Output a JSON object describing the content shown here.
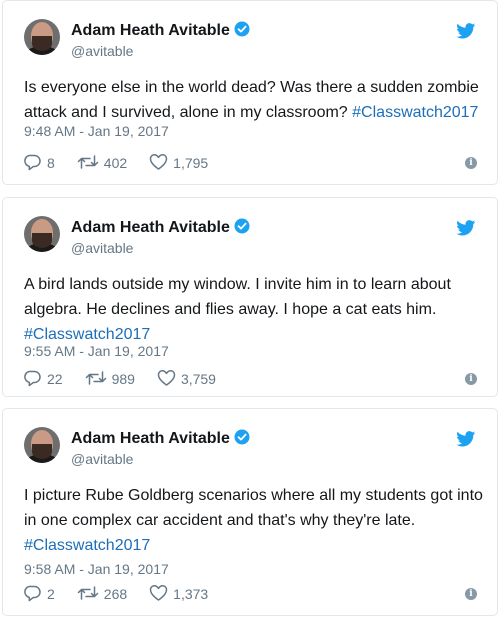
{
  "tweets": [
    {
      "author": "Adam Heath Avitable",
      "handle": "@avitable",
      "text": "Is everyone else in the world dead? Was there a sudden zombie attack and I survived, alone in my classroom? ",
      "hashtag": "#Classwatch2017",
      "date": "9:48 AM - Jan 19, 2017",
      "replies": "8",
      "retweets": "402",
      "likes": "1,795"
    },
    {
      "author": "Adam Heath Avitable",
      "handle": "@avitable",
      "text": "A bird lands outside my window. I invite him in to learn about algebra. He declines and flies away. I hope a cat eats him. ",
      "hashtag": "#Classwatch2017",
      "date": "9:55 AM - Jan 19, 2017",
      "replies": "22",
      "retweets": "989",
      "likes": "3,759"
    },
    {
      "author": "Adam Heath Avitable",
      "handle": "@avitable",
      "text": "I picture Rube Goldberg scenarios where all my students got into in one complex car accident and that's why they're late. ",
      "hashtag": "#Classwatch2017",
      "date": "9:58 AM - Jan 19, 2017",
      "replies": "2",
      "retweets": "268",
      "likes": "1,373"
    }
  ],
  "icons": {
    "verified": "verified-badge-icon",
    "brand": "twitter-bird-icon",
    "reply": "reply-icon",
    "retweet": "retweet-icon",
    "like": "heart-icon",
    "info": "info-icon"
  },
  "colors": {
    "brand": "#1da1f2",
    "hashtag": "#1b6fb8",
    "muted": "#657786",
    "border": "#e1e8ed"
  }
}
